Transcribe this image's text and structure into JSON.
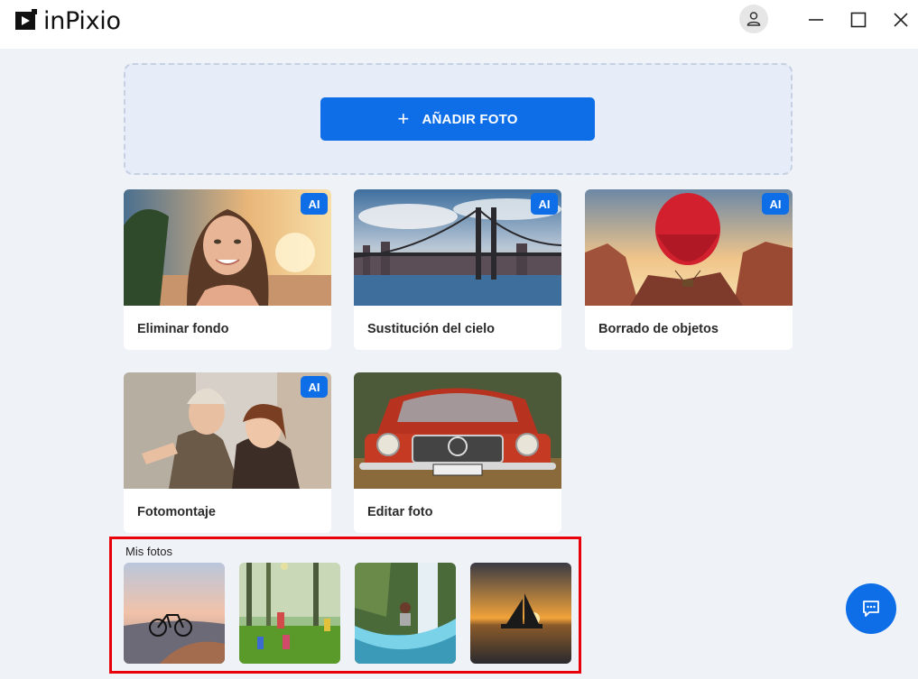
{
  "app": {
    "name": "inPixio"
  },
  "toolbar": {
    "account_icon": "user-icon",
    "minimize_icon": "minimize-icon",
    "maximize_icon": "maximize-icon",
    "close_icon": "close-icon"
  },
  "dropzone": {
    "add_photo_label": "AÑADIR FOTO",
    "add_icon": "plus-icon"
  },
  "tools": [
    {
      "label": "Eliminar fondo",
      "badge": "AI"
    },
    {
      "label": "Sustitución del cielo",
      "badge": "AI"
    },
    {
      "label": "Borrado de objetos",
      "badge": "AI"
    },
    {
      "label": "Fotomontaje",
      "badge": "AI"
    },
    {
      "label": "Editar foto",
      "badge": ""
    }
  ],
  "my_photos": {
    "title": "Mis fotos",
    "count": 4
  },
  "chat": {
    "icon": "chat-icon"
  },
  "colors": {
    "accent": "#0d6ee8",
    "highlight_border": "#e8000b",
    "background": "#eff2f7"
  }
}
